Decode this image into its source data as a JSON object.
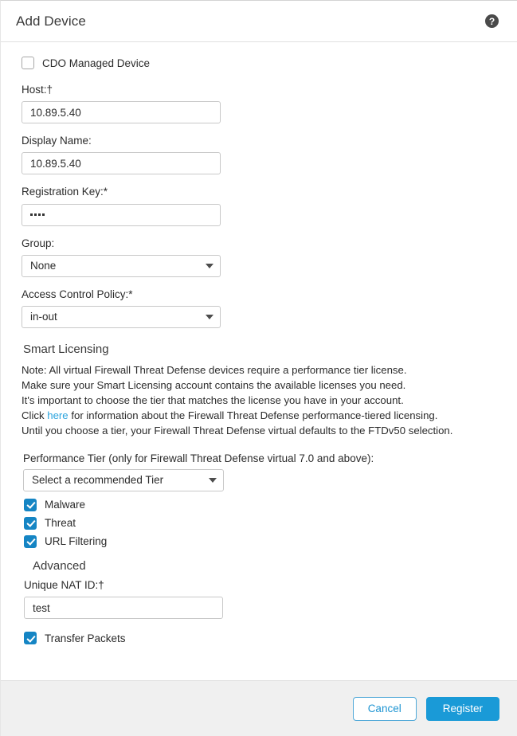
{
  "header": {
    "title": "Add Device",
    "help_icon": "help-circle-icon",
    "help_glyph": "?"
  },
  "form": {
    "cdo_managed": {
      "label": "CDO Managed Device",
      "checked": false
    },
    "host": {
      "label": "Host:†",
      "value": "10.89.5.40"
    },
    "display_name": {
      "label": "Display Name:",
      "value": "10.89.5.40"
    },
    "registration_key": {
      "label": "Registration Key:*",
      "value": "••••",
      "masked_char_count": 4
    },
    "group": {
      "label": "Group:",
      "value": "None"
    },
    "access_control_policy": {
      "label": "Access Control Policy:*",
      "value": "in-out"
    }
  },
  "smart_licensing": {
    "title": "Smart Licensing",
    "note_lines": [
      "Note: All virtual Firewall Threat Defense devices require a performance tier license.",
      "Make sure your Smart Licensing account contains the available licenses you need.",
      "It's important to choose the tier that matches the license you have in your account."
    ],
    "link_line": {
      "prefix": "Click ",
      "link_text": "here",
      "suffix": " for information about the Firewall Threat Defense performance-tiered licensing."
    },
    "final_line": "Until you choose a tier, your Firewall Threat Defense virtual defaults to the FTDv50 selection.",
    "performance_tier": {
      "label": "Performance Tier (only for Firewall Threat Defense virtual 7.0 and above):",
      "value": "Select a recommended Tier"
    },
    "licenses": [
      {
        "label": "Malware",
        "checked": true
      },
      {
        "label": "Threat",
        "checked": true
      },
      {
        "label": "URL Filtering",
        "checked": true
      }
    ]
  },
  "advanced": {
    "title": "Advanced",
    "unique_nat_id": {
      "label": "Unique NAT ID:†",
      "value": "test"
    },
    "transfer_packets": {
      "label": "Transfer Packets",
      "checked": true
    }
  },
  "footer": {
    "cancel_label": "Cancel",
    "register_label": "Register"
  },
  "colors": {
    "accent_blue": "#1a9ad7",
    "checkbox_blue": "#1585c4",
    "link_blue": "#2ba4de",
    "footer_bg": "#f0f0f0"
  }
}
